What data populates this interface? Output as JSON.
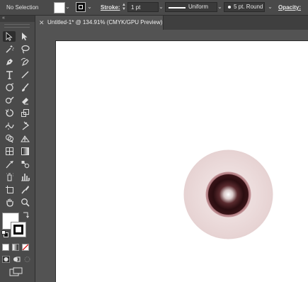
{
  "control_bar": {
    "selection_label": "No Selection",
    "fill_icon": "fill-swatch",
    "stroke_swatch_icon": "stroke-swatch",
    "stroke_label": "Stroke:",
    "stroke_weight": "1 pt",
    "variable_width_profile": "Uniform",
    "brush_definition": "5 pt. Round",
    "opacity_label": "Opacity:",
    "fill_color": "#ffffff",
    "stroke_color": "#111111"
  },
  "document_tab": {
    "close_glyph": "✕",
    "title": "Untitled-1* @ 134.91% (CMYK/GPU Preview)"
  },
  "tools_panel": {
    "collapse_glyph": "«",
    "tools": [
      {
        "name": "selection-tool",
        "icon": "arrow-black"
      },
      {
        "name": "direct-selection-tool",
        "icon": "arrow-white"
      },
      {
        "name": "magic-wand-tool",
        "icon": "wand"
      },
      {
        "name": "lasso-tool",
        "icon": "lasso"
      },
      {
        "name": "pen-tool",
        "icon": "pen"
      },
      {
        "name": "curvature-tool",
        "icon": "curvature-pen"
      },
      {
        "name": "type-tool",
        "icon": "type-T"
      },
      {
        "name": "line-segment-tool",
        "icon": "line"
      },
      {
        "name": "ellipse-tool",
        "icon": "ellipse"
      },
      {
        "name": "paintbrush-tool",
        "icon": "brush"
      },
      {
        "name": "shaper-tool",
        "icon": "shaper"
      },
      {
        "name": "eraser-tool",
        "icon": "eraser"
      },
      {
        "name": "rotate-tool",
        "icon": "rotate"
      },
      {
        "name": "scale-tool",
        "icon": "scale"
      },
      {
        "name": "width-tool",
        "icon": "width"
      },
      {
        "name": "puppet-warp-tool",
        "icon": "pin"
      },
      {
        "name": "shape-builder-tool",
        "icon": "shape-builder"
      },
      {
        "name": "perspective-grid-tool",
        "icon": "perspective"
      },
      {
        "name": "mesh-tool",
        "icon": "mesh"
      },
      {
        "name": "gradient-tool",
        "icon": "gradient"
      },
      {
        "name": "eyedropper-tool",
        "icon": "eyedropper"
      },
      {
        "name": "blend-tool",
        "icon": "blend"
      },
      {
        "name": "symbol-sprayer-tool",
        "icon": "sprayer"
      },
      {
        "name": "column-graph-tool",
        "icon": "graph"
      },
      {
        "name": "artboard-tool",
        "icon": "artboard"
      },
      {
        "name": "slice-tool",
        "icon": "knife"
      },
      {
        "name": "hand-tool",
        "icon": "hand"
      },
      {
        "name": "zoom-tool",
        "icon": "magnifier"
      }
    ],
    "fill_color": "#ffffff",
    "stroke_color": "#000000"
  },
  "canvas": {
    "artboard_color": "#ffffff",
    "pasteboard_color": "#535353",
    "eye_outer_color": "#ecdcdc",
    "eye_ring_color": "#a0606a",
    "eye_iris_color": "#2a0d10",
    "eye_highlight_color": "#ffffff"
  }
}
